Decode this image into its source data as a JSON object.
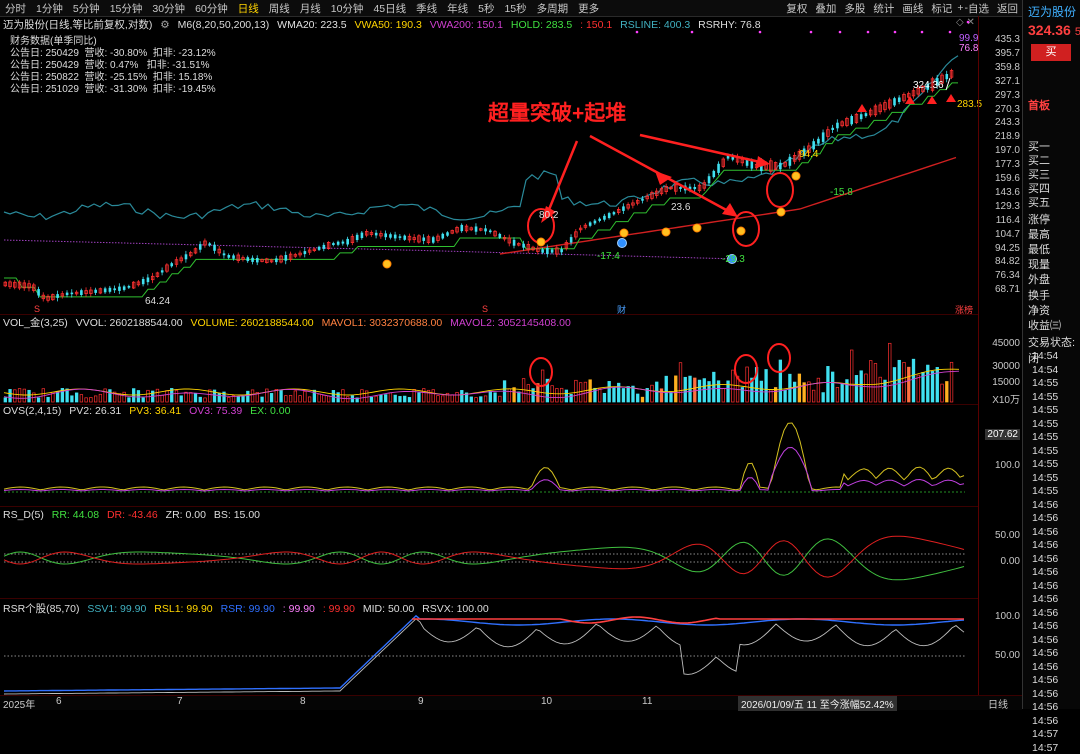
{
  "toolbar": {
    "periods": [
      "分时",
      "1分钟",
      "5分钟",
      "15分钟",
      "30分钟",
      "60分钟",
      "日线",
      "周线",
      "月线",
      "10分钟",
      "45日线",
      "季线",
      "年线",
      "5秒",
      "15秒",
      "多周期",
      "更多"
    ],
    "active_period": "日线",
    "tools": [
      "复权",
      "叠加",
      "多股",
      "统计",
      "画线",
      "自选",
      "返回"
    ],
    "mark_label": "标记",
    "mark_icon": "+",
    "zixuan_prefix": "-"
  },
  "header": {
    "stock_label": "迈为股份(日线,等比前复权,对数)",
    "ma_label": "M6(8,20,50,200,13)",
    "wma20": "WMA20: 223.5",
    "vwa50": "VWA50: 190.3",
    "vwa200": "VWA200: 150.1",
    "hold": "HOLD: 283.5",
    "hold2": ": 150.1",
    "rsline": "RSLINE: 400.3",
    "rsrhy": "RSRHY: 76.8"
  },
  "financials": {
    "title": "财务数据(单季同比)",
    "rows": [
      "公告日: 250429  营收: -30.80%  扣非: -23.12%",
      "公告日: 250429  营收: 0.47%   扣非: -31.51%",
      "公告日: 250822  营收: -25.15%  扣非: 15.18%",
      "公告日: 251029  营收: -31.30%  扣非: -19.45%"
    ]
  },
  "annotation": {
    "text": "超量突破+起堆",
    "color": "#ff2020"
  },
  "price_labels": {
    "low": "64.24",
    "p1": "80.2",
    "p2": "23.6",
    "p3": "-17.4",
    "p4": "-29.3",
    "p5": "94.4",
    "p6": "-15.8",
    "last": "324.36",
    "hold_tag": "283.5",
    "rs_top": "99.9",
    "rs_val": "76.8"
  },
  "price_axis": [
    "435.3",
    "395.7",
    "359.8",
    "327.1",
    "297.3",
    "270.3",
    "243.3",
    "218.9",
    "197.0",
    "177.3",
    "159.6",
    "143.6",
    "129.3",
    "116.4",
    "104.7",
    "94.25",
    "84.82",
    "76.34",
    "68.71"
  ],
  "event_markers": [
    {
      "label": "S",
      "color": "#ff4040"
    },
    {
      "label": "S",
      "color": "#ff4040"
    },
    {
      "label": "财",
      "color": "#4aa0ff"
    },
    {
      "label": "涨榜",
      "color": "#ff4040"
    }
  ],
  "vol_panel": {
    "title": "VOL_金(3,25)",
    "vvol": "VVOL: 2602188544.00",
    "volume": "VOLUME: 2602188544.00",
    "mavol1": "MAVOL1: 3032370688.00",
    "mavol2": "MAVOL2: 3052145408.00",
    "axis": [
      "45000",
      "30000",
      "15000"
    ],
    "unit": "X10万"
  },
  "ovs_panel": {
    "title": "OVS(2,4,15)",
    "pv2": "PV2: 26.31",
    "pv3": "PV3: 36.41",
    "ov3": "OV3: 75.39",
    "ex": "EX: 0.00",
    "axis": [
      "207.62",
      "100.0"
    ]
  },
  "rsd_panel": {
    "title": "RS_D(5)",
    "rr": "RR: 44.08",
    "dr": "DR: -43.46",
    "zr": "ZR: 0.00",
    "bs": "BS: 15.00",
    "axis": [
      "50.00",
      "0.00"
    ]
  },
  "rsr_panel": {
    "title": "RSR个股(85,70)",
    "ssv1": "SSV1: 99.90",
    "rsl1": "RSL1: 99.90",
    "rsr": "RSR: 99.90",
    "v4": ": 99.90",
    "v5": ": 99.90",
    "mid": "MID: 50.00",
    "rsvx": "RSVX: 100.00",
    "axis": [
      "100.0",
      "50.00"
    ]
  },
  "bottom": {
    "year": "2025年",
    "months": [
      "6",
      "7",
      "8",
      "9",
      "10",
      "11"
    ],
    "range_text": "2026/01/09/五 11 至今涨幅52.42%",
    "period": "日线"
  },
  "right_panel": {
    "name": "迈为股份",
    "name_suffix": "3",
    "price": "324.36",
    "price_suffix": "5",
    "buy": "买",
    "board": "首板",
    "levels": [
      "买一",
      "买二",
      "买三",
      "买四",
      "买五"
    ],
    "stats": [
      "涨停",
      "最高",
      "最低",
      "现量",
      "外盘"
    ],
    "extra": [
      "换手",
      "净资",
      "收益㈢"
    ],
    "trade_status": "交易状态: 闭",
    "times": [
      "14:54",
      "14:54",
      "14:55",
      "14:55",
      "14:55",
      "14:55",
      "14:55",
      "14:55",
      "14:55",
      "14:55",
      "14:55",
      "14:56",
      "14:56",
      "14:56",
      "14:56",
      "14:56",
      "14:56",
      "14:56",
      "14:56",
      "14:56",
      "14:56",
      "14:56",
      "14:56",
      "14:56",
      "14:56",
      "14:56",
      "14:56",
      "14:56",
      "14:57",
      "14:57"
    ]
  },
  "colors": {
    "up": "#ff3030",
    "down": "#40e0f0",
    "accent": "#ffd400"
  }
}
